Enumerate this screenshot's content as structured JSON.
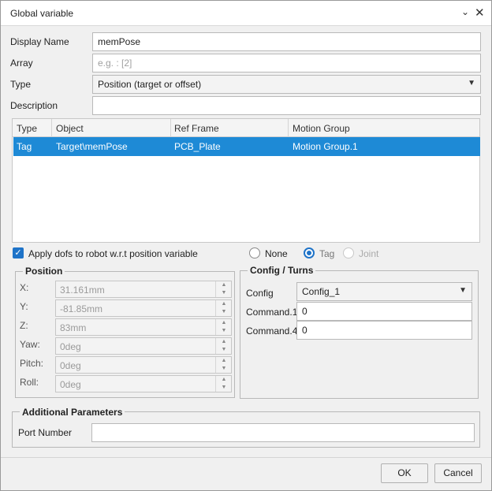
{
  "window": {
    "title": "Global variable",
    "minimize_icon": "chevron-down-icon",
    "close_icon": "close-icon"
  },
  "form": {
    "display_name_label": "Display Name",
    "display_name_value": "memPose",
    "array_label": "Array",
    "array_placeholder": "e.g. : [2]",
    "type_label": "Type",
    "type_value": "Position (target or offset)",
    "description_label": "Description",
    "description_value": ""
  },
  "table": {
    "columns": [
      "Type",
      "Object",
      "Ref Frame",
      "Motion Group"
    ],
    "rows": [
      [
        "Tag",
        "Target\\memPose",
        "PCB_Plate",
        "Motion Group.1"
      ]
    ],
    "selected_color": "#1e8ad6"
  },
  "options": {
    "apply_dofs_label": "Apply dofs to robot w.r.t position variable",
    "apply_dofs_checked": true,
    "radio_none": "None",
    "radio_tag": "Tag",
    "radio_joint": "Joint",
    "radio_selected": "Tag"
  },
  "position": {
    "title": "Position",
    "fields": [
      {
        "label": "X:",
        "value": "31.161mm"
      },
      {
        "label": "Y:",
        "value": "-81.85mm"
      },
      {
        "label": "Z:",
        "value": "83mm"
      },
      {
        "label": "Yaw:",
        "value": "0deg"
      },
      {
        "label": "Pitch:",
        "value": "0deg"
      },
      {
        "label": "Roll:",
        "value": "0deg"
      }
    ]
  },
  "config": {
    "title": "Config / Turns",
    "config_label": "Config",
    "config_value": "Config_1",
    "command1_label": "Command.1",
    "command1_value": "0",
    "command4_label": "Command.4",
    "command4_value": "0"
  },
  "additional": {
    "title": "Additional Parameters",
    "port_label": "Port Number",
    "port_value": ""
  },
  "buttons": {
    "ok": "OK",
    "cancel": "Cancel"
  },
  "colors": {
    "accent": "#1e73c8"
  }
}
